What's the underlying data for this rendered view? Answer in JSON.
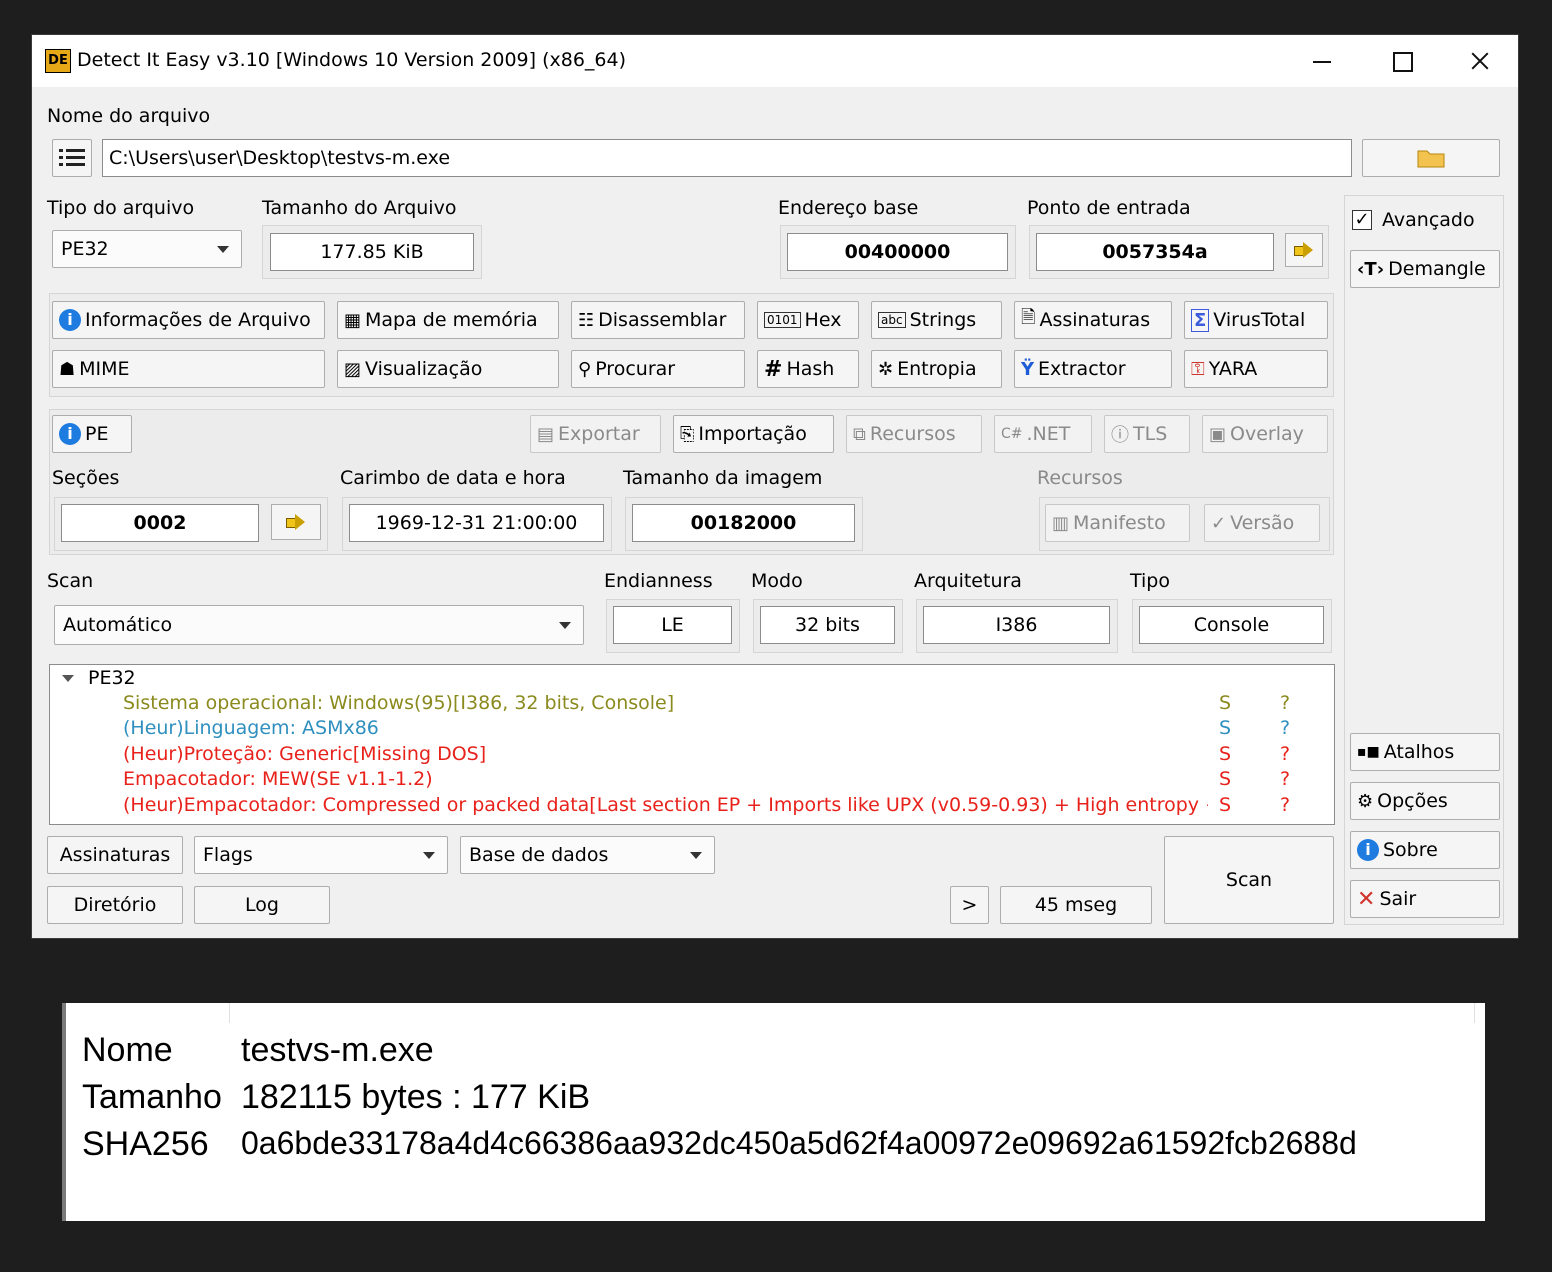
{
  "window": {
    "app_icon_text": "DE",
    "title": "Detect It Easy v3.10 [Windows 10 Version 2009] (x86_64)"
  },
  "file": {
    "label": "Nome do arquivo",
    "path": "C:\\Users\\user\\Desktop\\testvs-m.exe"
  },
  "file_type": {
    "label": "Tipo do arquivo",
    "value": "PE32"
  },
  "file_size": {
    "label": "Tamanho do Arquivo",
    "value": "177.85 KiB"
  },
  "base_address": {
    "label": "Endereço base",
    "value": "00400000"
  },
  "entry_point": {
    "label": "Ponto de entrada",
    "value": "0057354a"
  },
  "advanced": {
    "label": "Avançado",
    "checked": true
  },
  "demangle": {
    "label": "Demangle"
  },
  "tools_row1": [
    {
      "label": "Informações de Arquivo",
      "icon": "info-icon"
    },
    {
      "label": "Mapa de memória",
      "icon": "memory-icon"
    },
    {
      "label": "Disassemblar",
      "icon": "disassembly-icon"
    },
    {
      "label": "Hex",
      "icon": "hex-icon"
    },
    {
      "label": "Strings",
      "icon": "strings-icon"
    },
    {
      "label": "Assinaturas",
      "icon": "signature-icon"
    },
    {
      "label": "VirusTotal",
      "icon": "virustotal-icon"
    }
  ],
  "tools_row2": [
    {
      "label": "MIME",
      "icon": "mime-icon"
    },
    {
      "label": "Visualização",
      "icon": "image-icon"
    },
    {
      "label": "Procurar",
      "icon": "search-icon"
    },
    {
      "label": "Hash",
      "icon": "hash-icon"
    },
    {
      "label": "Entropia",
      "icon": "entropy-icon"
    },
    {
      "label": "Extractor",
      "icon": "extractor-icon"
    },
    {
      "label": "YARA",
      "icon": "yara-icon"
    }
  ],
  "pe": {
    "pe_button": "PE",
    "exportar": "Exportar",
    "importacao": "Importação",
    "recursos_btn": "Recursos",
    "net": ".NET",
    "net_prefix": "C#",
    "tls": "TLS",
    "overlay": "Overlay",
    "sections_label": "Seções",
    "sections_value": "0002",
    "timestamp_label": "Carimbo de data e hora",
    "timestamp_value": "1969-12-31 21:00:00",
    "image_size_label": "Tamanho da imagem",
    "image_size_value": "00182000",
    "resources_label": "Recursos",
    "manifest": "Manifesto",
    "version": "Versão"
  },
  "scan": {
    "label": "Scan",
    "mode_value": "Automático",
    "endianness_label": "Endianness",
    "endianness_value": "LE",
    "mode_label": "Modo",
    "mode_bits": "32 bits",
    "arch_label": "Arquitetura",
    "arch_value": "I386",
    "type_label": "Tipo",
    "type_value": "Console"
  },
  "results": {
    "root": "PE32",
    "rows": [
      {
        "text": "Sistema operacional: Windows(95)[I386, 32 bits, Console]",
        "color": "#8a8a1e",
        "s": "S",
        "q": "?"
      },
      {
        "text": "(Heur)Linguagem: ASMx86",
        "color": "#2f8fbf",
        "s": "S",
        "q": "?"
      },
      {
        "text": "(Heur)Proteção: Generic[Missing DOS]",
        "color": "#e8221b",
        "s": "S",
        "q": "?"
      },
      {
        "text": "Empacotador: MEW(SE v1.1-1.2)",
        "color": "#e8221b",
        "s": "S",
        "q": "?"
      },
      {
        "text": "(Heur)Empacotador: Compressed or packed data[Last section EP + Imports like UPX (v0.59-0.93) + High entropy + Sect...",
        "color": "#e8221b",
        "s": "S",
        "q": "?"
      }
    ]
  },
  "bottom": {
    "assinaturas": "Assinaturas",
    "flags": "Flags",
    "database": "Base de dados",
    "diretorio": "Diretório",
    "log": "Log",
    "more": ">",
    "time": "45 mseg",
    "scan": "Scan"
  },
  "side": {
    "atalhos": "Atalhos",
    "opcoes": "Opções",
    "sobre": "Sobre",
    "sair": "Sair"
  },
  "info_panel": {
    "name_key": "Nome",
    "name_value": "testvs-m.exe",
    "size_key": "Tamanho",
    "size_value": "182115 bytes : 177 KiB",
    "sha_key": "SHA256",
    "sha_value": "0a6bde33178a4d4c66386aa932dc450a5d62f4a00972e09692a61592fcb2688d"
  },
  "colors": {
    "window_bg": "#f0f0f0",
    "outer_bg": "#1e1e1e",
    "yellow_os": "#8a8a1e",
    "teal_lang": "#2f8fbf",
    "red_detect": "#e8221b"
  }
}
